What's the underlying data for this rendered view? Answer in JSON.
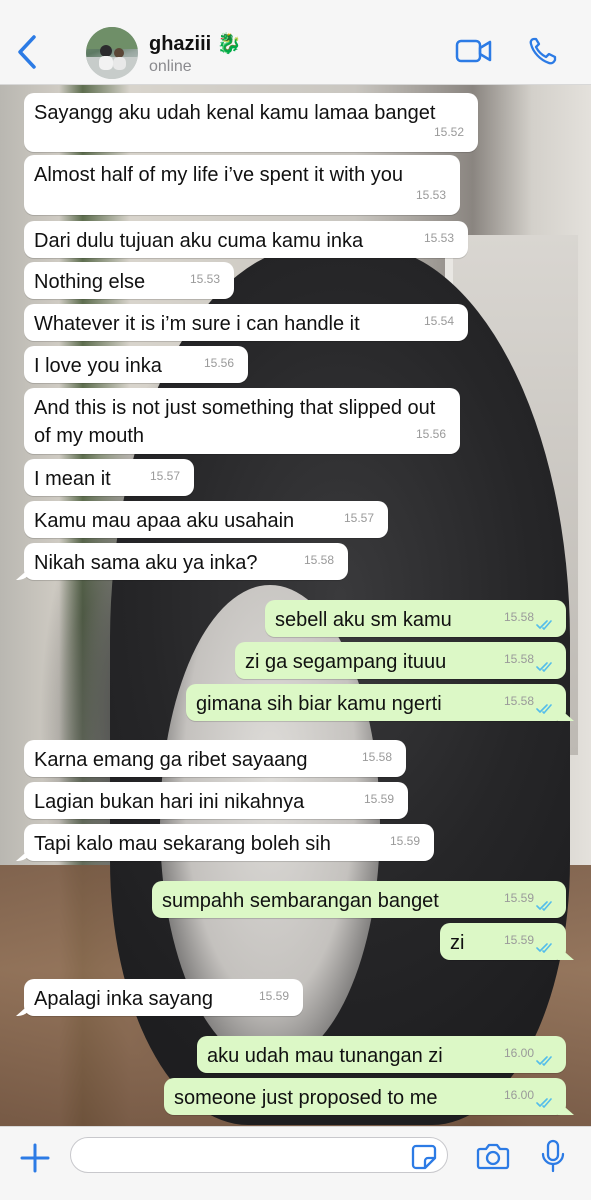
{
  "header": {
    "back_icon": "chevron-left-icon",
    "contact_name": "ghaziii 🐉",
    "status": "online",
    "video_icon": "video-camera-icon",
    "call_icon": "phone-icon"
  },
  "colors": {
    "accent": "#2c7be5",
    "incoming_bubble": "#ffffff",
    "outgoing_bubble": "#dcf8c6",
    "read_ticks": "#53bdeb"
  },
  "messages": [
    {
      "dir": "in",
      "text": "Sayangg aku udah kenal kamu lamaa banget",
      "time": "15.52"
    },
    {
      "dir": "in",
      "text": "Almost half of my life i’ve spent it with you",
      "time": "15.53"
    },
    {
      "dir": "in",
      "text": "Dari dulu tujuan aku cuma kamu inka",
      "time": "15.53"
    },
    {
      "dir": "in",
      "text": "Nothing else",
      "time": "15.53"
    },
    {
      "dir": "in",
      "text": "Whatever it is i’m sure i can handle it",
      "time": "15.54"
    },
    {
      "dir": "in",
      "text": "I love you inka",
      "time": "15.56"
    },
    {
      "dir": "in",
      "text": "And this is not just something that slipped out of my mouth",
      "time": "15.56"
    },
    {
      "dir": "in",
      "text": "I mean it",
      "time": "15.57"
    },
    {
      "dir": "in",
      "text": "Kamu mau apaa aku usahain",
      "time": "15.57"
    },
    {
      "dir": "in",
      "text": "Nikah sama aku ya inka?",
      "time": "15.58"
    },
    {
      "dir": "out",
      "text": "sebell aku sm kamu",
      "time": "15.58"
    },
    {
      "dir": "out",
      "text": "zi ga segampang ituuu",
      "time": "15.58"
    },
    {
      "dir": "out",
      "text": "gimana sih biar kamu ngerti",
      "time": "15.58"
    },
    {
      "dir": "in",
      "text": "Karna emang ga ribet sayaang",
      "time": "15.58"
    },
    {
      "dir": "in",
      "text": "Lagian bukan hari ini nikahnya",
      "time": "15.59"
    },
    {
      "dir": "in",
      "text": "Tapi kalo mau sekarang boleh sih",
      "time": "15.59"
    },
    {
      "dir": "out",
      "text": "sumpahh sembarangan banget",
      "time": "15.59"
    },
    {
      "dir": "out",
      "text": "zi",
      "time": "15.59"
    },
    {
      "dir": "in",
      "text": "Apalagi inka sayang",
      "time": "15.59"
    },
    {
      "dir": "out",
      "text": "aku udah mau tunangan zi",
      "time": "16.00"
    },
    {
      "dir": "out",
      "text": "someone just proposed to me",
      "time": "16.00"
    }
  ],
  "footer": {
    "plus_icon": "plus-icon",
    "input_value": "",
    "sticker_icon": "sticker-icon",
    "camera_icon": "camera-icon",
    "mic_icon": "microphone-icon"
  }
}
